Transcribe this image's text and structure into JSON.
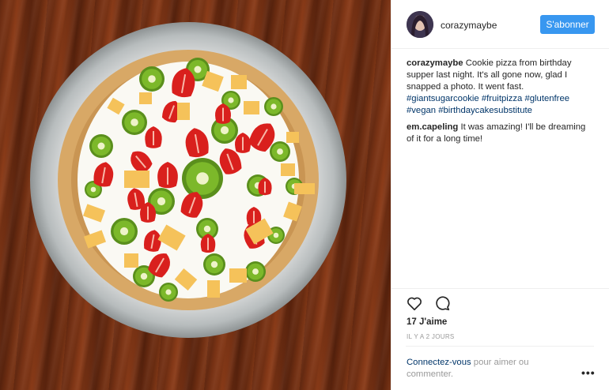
{
  "post": {
    "username": "corazymaybe",
    "follow_label": "S'abonner",
    "caption": {
      "user": "corazymaybe",
      "text": "Cookie pizza from birthday supper last night. It's all gone now, glad I snapped a photo. It went fast.",
      "hashtags": [
        "#giantsugarcookie",
        "#fruitpizza",
        "#glutenfree",
        "#vegan",
        "#birthdaycakesubstitute"
      ]
    },
    "comments": [
      {
        "user": "em.capeling",
        "text": "It was amazing! I'll be dreaming of it for a long time!"
      }
    ],
    "likes": "17 J'aime",
    "timestamp": "IL Y A 2 JOURS",
    "login": {
      "link": "Connectez-vous",
      "rest": "pour aimer ou commenter."
    },
    "more_label": "•••"
  },
  "icons": {
    "like": "heart-icon",
    "comment": "comment-icon",
    "more": "more-options-icon",
    "avatar": "avatar"
  },
  "colors": {
    "accent": "#3897f0",
    "link": "#003569",
    "muted": "#999999",
    "text": "#262626"
  }
}
